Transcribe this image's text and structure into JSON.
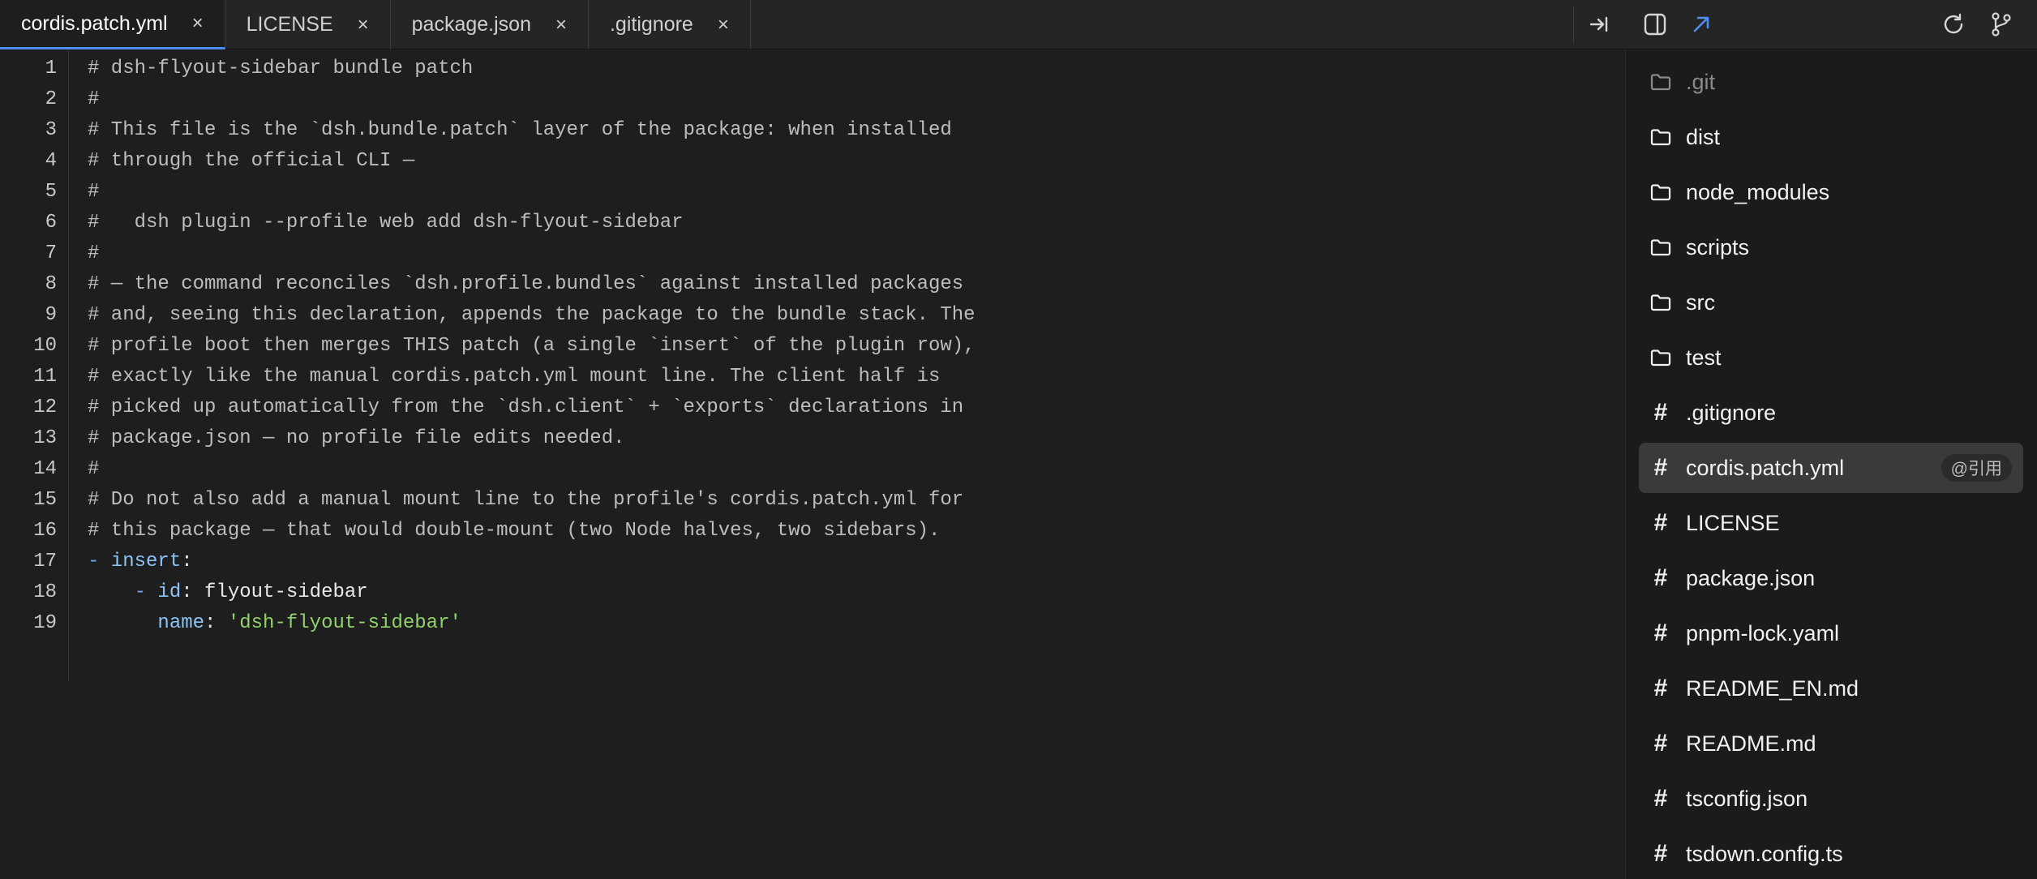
{
  "tabs": [
    {
      "label": "cordis.patch.yml",
      "active": true
    },
    {
      "label": "LICENSE",
      "active": false
    },
    {
      "label": "package.json",
      "active": false
    },
    {
      "label": ".gitignore",
      "active": false
    }
  ],
  "tab_close_glyph": "×",
  "toolbar_icons": [
    "collapse-right-icon",
    "split-panel-icon",
    "open-external-icon",
    "refresh-icon",
    "git-branch-icon"
  ],
  "colors": {
    "accent": "#4d8ff0",
    "comment": "#bdbdbd",
    "yaml_key": "#8cc3f6",
    "yaml_string": "#8fd16a"
  },
  "editor": {
    "lines": [
      {
        "n": "1",
        "tokens": [
          {
            "t": "comment",
            "v": "# dsh-flyout-sidebar bundle patch"
          }
        ]
      },
      {
        "n": "2",
        "tokens": [
          {
            "t": "comment",
            "v": "#"
          }
        ]
      },
      {
        "n": "3",
        "tokens": [
          {
            "t": "comment",
            "v": "# This file is the `dsh.bundle.patch` layer of the package: when installed"
          }
        ]
      },
      {
        "n": "4",
        "tokens": [
          {
            "t": "comment",
            "v": "# through the official CLI —"
          }
        ]
      },
      {
        "n": "5",
        "tokens": [
          {
            "t": "comment",
            "v": "#"
          }
        ]
      },
      {
        "n": "6",
        "tokens": [
          {
            "t": "comment",
            "v": "#   dsh plugin --profile web add dsh-flyout-sidebar"
          }
        ]
      },
      {
        "n": "7",
        "tokens": [
          {
            "t": "comment",
            "v": "#"
          }
        ]
      },
      {
        "n": "8",
        "tokens": [
          {
            "t": "comment",
            "v": "# — the command reconciles `dsh.profile.bundles` against installed packages"
          }
        ]
      },
      {
        "n": "9",
        "tokens": [
          {
            "t": "comment",
            "v": "# and, seeing this declaration, appends the package to the bundle stack. The"
          }
        ]
      },
      {
        "n": "10",
        "tokens": [
          {
            "t": "comment",
            "v": "# profile boot then merges THIS patch (a single `insert` of the plugin row),"
          }
        ]
      },
      {
        "n": "11",
        "tokens": [
          {
            "t": "comment",
            "v": "# exactly like the manual cordis.patch.yml mount line. The client half is"
          }
        ]
      },
      {
        "n": "12",
        "tokens": [
          {
            "t": "comment",
            "v": "# picked up automatically from the `dsh.client` + `exports` declarations in"
          }
        ]
      },
      {
        "n": "13",
        "tokens": [
          {
            "t": "comment",
            "v": "# package.json — no profile file edits needed."
          }
        ]
      },
      {
        "n": "14",
        "tokens": [
          {
            "t": "comment",
            "v": "#"
          }
        ]
      },
      {
        "n": "15",
        "tokens": [
          {
            "t": "comment",
            "v": "# Do not also add a manual mount line to the profile's cordis.patch.yml for"
          }
        ]
      },
      {
        "n": "16",
        "tokens": [
          {
            "t": "comment",
            "v": "# this package — that would double-mount (two Node halves, two sidebars)."
          }
        ]
      },
      {
        "n": "17",
        "tokens": [
          {
            "t": "dash",
            "v": "- "
          },
          {
            "t": "key",
            "v": "insert"
          },
          {
            "t": "plain",
            "v": ":"
          }
        ]
      },
      {
        "n": "18",
        "tokens": [
          {
            "t": "plain",
            "v": "    "
          },
          {
            "t": "dash",
            "v": "- "
          },
          {
            "t": "key",
            "v": "id"
          },
          {
            "t": "plain",
            "v": ": flyout-sidebar"
          }
        ]
      },
      {
        "n": "19",
        "tokens": [
          {
            "t": "plain",
            "v": "      "
          },
          {
            "t": "key",
            "v": "name"
          },
          {
            "t": "plain",
            "v": ": "
          },
          {
            "t": "string",
            "v": "'dsh-flyout-sidebar'"
          }
        ]
      }
    ]
  },
  "file_tree": {
    "items": [
      {
        "label": ".git",
        "kind": "folder",
        "dim": true
      },
      {
        "label": "dist",
        "kind": "folder"
      },
      {
        "label": "node_modules",
        "kind": "folder"
      },
      {
        "label": "scripts",
        "kind": "folder"
      },
      {
        "label": "src",
        "kind": "folder"
      },
      {
        "label": "test",
        "kind": "folder"
      },
      {
        "label": ".gitignore",
        "kind": "file"
      },
      {
        "label": "cordis.patch.yml",
        "kind": "file",
        "selected": true,
        "badge": "@引用"
      },
      {
        "label": "LICENSE",
        "kind": "file"
      },
      {
        "label": "package.json",
        "kind": "file"
      },
      {
        "label": "pnpm-lock.yaml",
        "kind": "file"
      },
      {
        "label": "README_EN.md",
        "kind": "file"
      },
      {
        "label": "README.md",
        "kind": "file"
      },
      {
        "label": "tsconfig.json",
        "kind": "file"
      },
      {
        "label": "tsdown.config.ts",
        "kind": "file"
      }
    ],
    "file_glyph": "#"
  }
}
